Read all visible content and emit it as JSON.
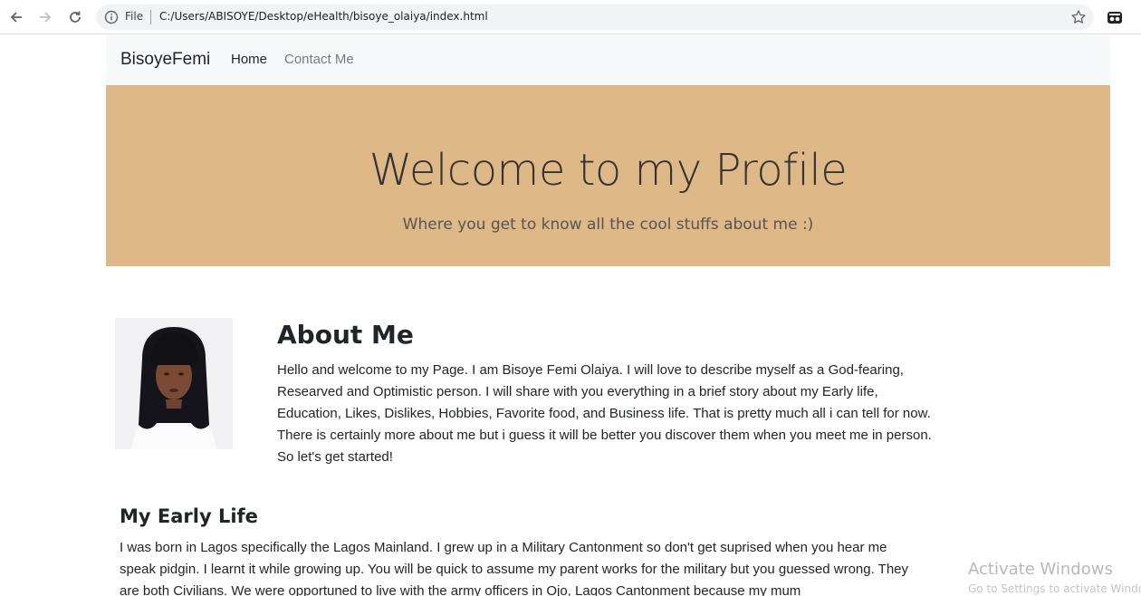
{
  "browser": {
    "file_label": "File",
    "url": "C:/Users/ABISOYE/Desktop/eHealth/bisoye_olaiya/index.html"
  },
  "navbar": {
    "brand": "BisoyeFemi",
    "links": [
      "Home",
      "Contact Me"
    ]
  },
  "hero": {
    "title": "Welcome to my Profile",
    "subtitle": "Where you get to know all the cool stuffs about me :)",
    "background_color": "#deb887"
  },
  "about": {
    "title": "About Me",
    "text": "Hello and welcome to my Page. I am Bisoye Femi Olaiya. I will love to describe myself as a God-fearing, Researved and Optimistic person. I will share with you everything in a brief story about my Early life, Education, Likes, Dislikes, Hobbies, Favorite food, and Business life. That is pretty much all i can tell for now. There is certainly more about me but i guess it will be better you discover them when you meet me in person. So let's get started!"
  },
  "early_life": {
    "title": "My Early Life",
    "text": "I was born in Lagos specifically the Lagos Mainland. I grew up in a Military Cantonment so don't get suprised when you hear me speak pidgin. I learnt it while growing up. You will be quick to assume my parent works for the military but you guessed wrong. They are both Civilians. We were opportuned to live with the army officers in Ojo, Lagos Cantonment because my mum"
  },
  "watermark": {
    "line1": "Activate Windows",
    "line2": "Go to Settings to activate Windows."
  }
}
